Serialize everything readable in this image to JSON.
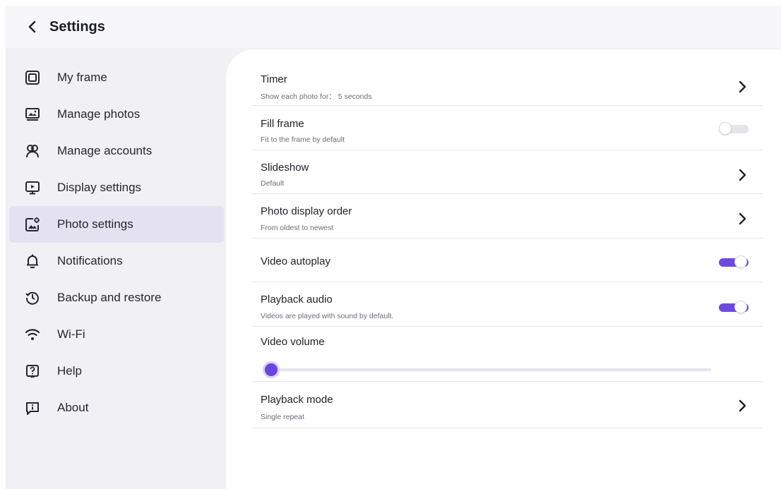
{
  "header": {
    "title": "Settings"
  },
  "sidebar": {
    "items": [
      {
        "label": "My frame",
        "icon": "frame-icon"
      },
      {
        "label": "Manage photos",
        "icon": "photos-icon"
      },
      {
        "label": "Manage accounts",
        "icon": "accounts-icon"
      },
      {
        "label": "Display settings",
        "icon": "display-icon"
      },
      {
        "label": "Photo settings",
        "icon": "photo-settings-icon",
        "active": true
      },
      {
        "label": "Notifications",
        "icon": "bell-icon"
      },
      {
        "label": "Backup and restore",
        "icon": "backup-icon"
      },
      {
        "label": "Wi-Fi",
        "icon": "wifi-icon"
      },
      {
        "label": "Help",
        "icon": "help-icon"
      },
      {
        "label": "About",
        "icon": "info-icon"
      }
    ]
  },
  "settings": {
    "timer": {
      "title": "Timer",
      "subtitle": "Show each photo for： 5 seconds"
    },
    "fill_frame": {
      "title": "Fill frame",
      "subtitle": "Fit to the frame by default",
      "enabled": false
    },
    "slideshow": {
      "title": "Slideshow",
      "subtitle": "Default"
    },
    "display_order": {
      "title": "Photo display order",
      "subtitle": "From oldest to newest"
    },
    "video_autoplay": {
      "title": "Video autoplay",
      "enabled": true
    },
    "playback_audio": {
      "title": "Playback audio",
      "subtitle": "Videos are played with sound by default.",
      "enabled": true
    },
    "video_volume": {
      "title": "Video volume",
      "level": 0
    },
    "playback_mode": {
      "title": "Playback mode",
      "subtitle": "Single repeat"
    }
  },
  "colors": {
    "accent": "#6e49e0",
    "active_nav_bg": "#e4e2f0",
    "sidebar_bg": "#f1f0f5"
  }
}
